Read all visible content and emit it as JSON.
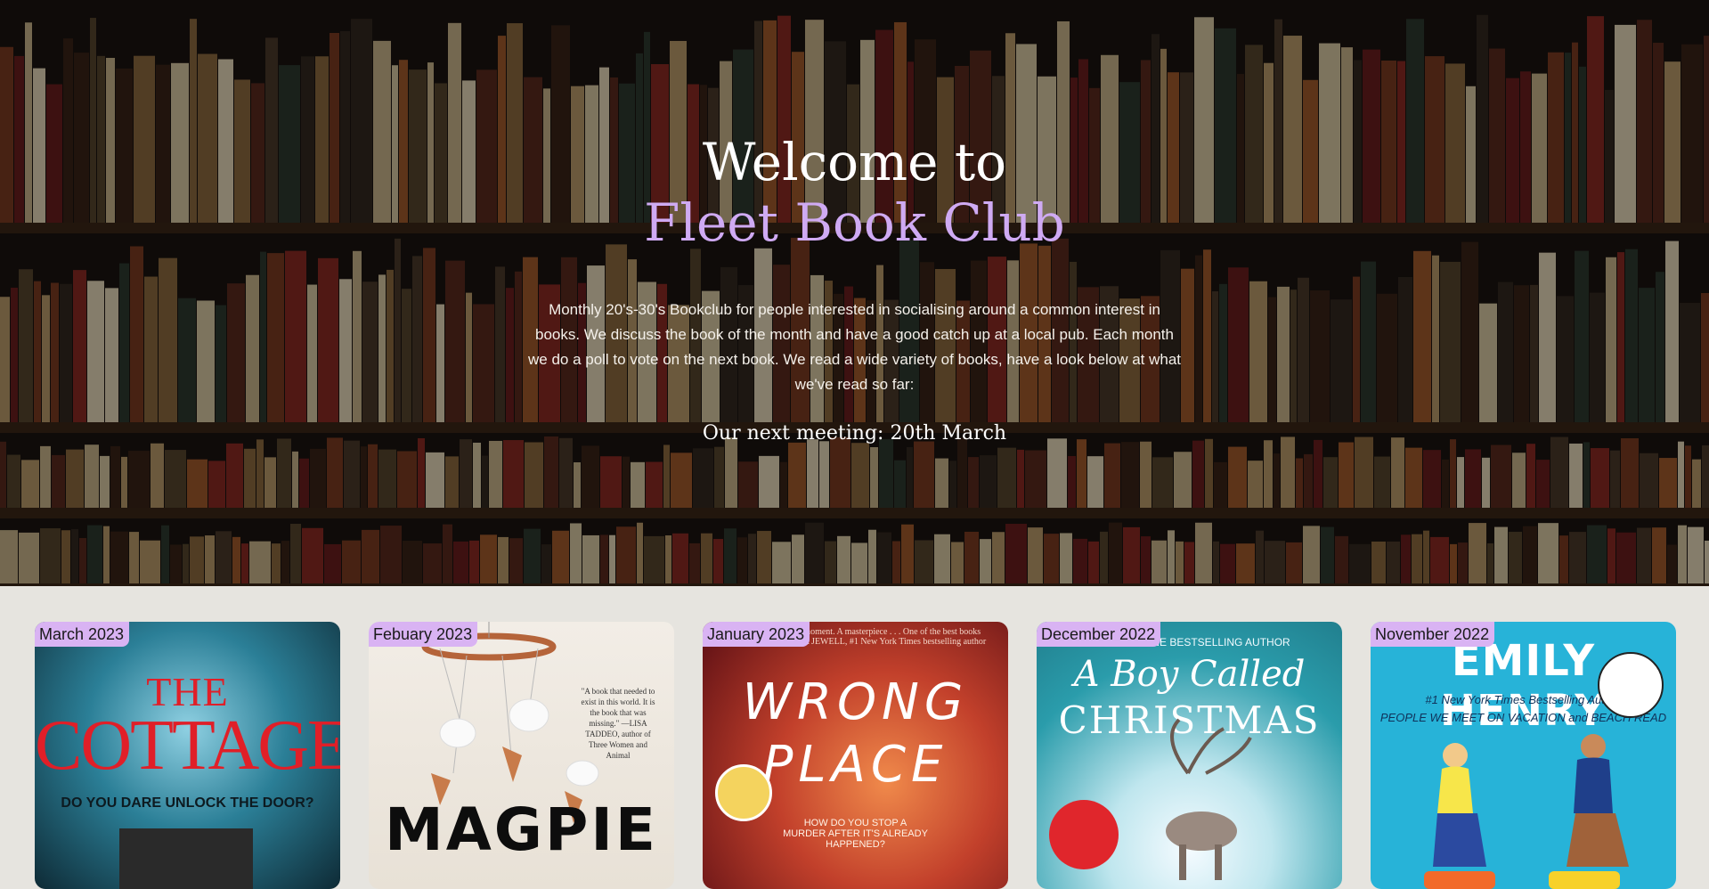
{
  "hero": {
    "title_line1": "Welcome to",
    "title_line2": "Fleet Book Club",
    "description": "Monthly 20's-30's Bookclub for people interested in socialising around a common interest in books. We discuss the book of the month and have a good catch up at a local pub. Each month we do a poll to vote on the next book. We read a wide variety of books, have a look below at what we've read so far:",
    "next_meeting": "Our next meeting: 20th March"
  },
  "colors": {
    "accent": "#cfaaf3",
    "date_badge": "#d9b3f3",
    "page_bg": "#e6e4df"
  },
  "books": [
    {
      "date": "March 2023",
      "cover_line1": "THE",
      "cover_line2": "COTTAGE",
      "cover_tagline": "DO YOU DARE UNLOCK THE DOOR?"
    },
    {
      "date": "Febuary 2023",
      "cover_title": "MAGPIE",
      "cover_quote": "\"A book that needed to exist in this world. It is the book that was missing.\" —LISA TADDEO, author of Three Women and Animal"
    },
    {
      "date": "January 2023",
      "cover_quote": "...every word, every moment. A masterpiece . . . One of the best books I've ever read.\" —LISA JEWELL, #1 New York Times bestselling author",
      "cover_line1": "WRONG",
      "cover_line2": "PLACE",
      "cover_tagline": "HOW DO YOU STOP A MURDER AFTER IT'S ALREADY HAPPENED?"
    },
    {
      "date": "December 2022",
      "cover_quote": "ONE BESTSELLING AUTHOR",
      "cover_line1": "A Boy Called",
      "cover_line2": "CHRISTMAS"
    },
    {
      "date": "November 2022",
      "cover_author": "EMILY HENRY",
      "cover_line1": "#1 New York Times Bestselling Author",
      "cover_line2": "PEOPLE WE MEET ON VACATION and BEACH READ"
    }
  ]
}
